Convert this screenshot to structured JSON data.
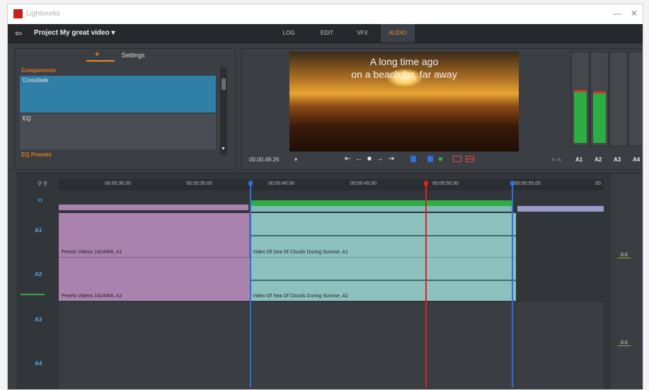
{
  "window": {
    "app_name": "Lightworks",
    "min_btn": "—",
    "close_btn": "✕"
  },
  "menubar": {
    "exit_icon": "⇦",
    "project_title": "Project My great video ▾",
    "room_tabs": [
      "LOG",
      "EDIT",
      "VFX",
      "AUDIO"
    ],
    "active_tab": "AUDIO"
  },
  "effects_panel": {
    "plus_tab": "+",
    "settings_tab": "Settings",
    "components_label": "Components",
    "items": [
      "Crossfade",
      "EQ"
    ],
    "presets_label": "EQ Presets",
    "scroll_down": "▼"
  },
  "viewer": {
    "subtitle_line1": "A long time ago",
    "subtitle_line2": "on a beach far, far away",
    "timecode": "00.00.49.26",
    "timecode_menu": "▾",
    "transport": "⇤ ← ■ → ⇥"
  },
  "meters": {
    "channels": [
      "A1",
      "A2",
      "A3",
      "A4"
    ],
    "headphone_icons": "∩ ∩"
  },
  "timeline": {
    "ruler_labels": [
      "00:00:30.00",
      "00:00:35.00",
      "00:00:40.00",
      "00:00:45.00",
      "00:00:50.00",
      "00:00:55.00",
      "00:"
    ],
    "ruler_icons": "⚲ ⚲",
    "tracks": [
      "V1",
      "A1",
      "A2",
      "A3",
      "A4"
    ],
    "clips": {
      "a1_left": "Pexels Videos 1424456, A1",
      "a1_right": "Video Of Sea Of Clouds During Sunrise, A1",
      "a2_left": "Pexels Videos 1424456, A2",
      "a2_right": "Video Of Sea Of Clouds During Sunrise, A2"
    },
    "levels": [
      "0.0",
      "0.0"
    ]
  },
  "colors": {
    "accent": "#f08a24",
    "clip_purple": "#a983ad",
    "clip_teal": "#8dc1c0",
    "playhead": "#e41e1e",
    "marker": "#2f6fd8",
    "meter_green": "#2cae43"
  }
}
